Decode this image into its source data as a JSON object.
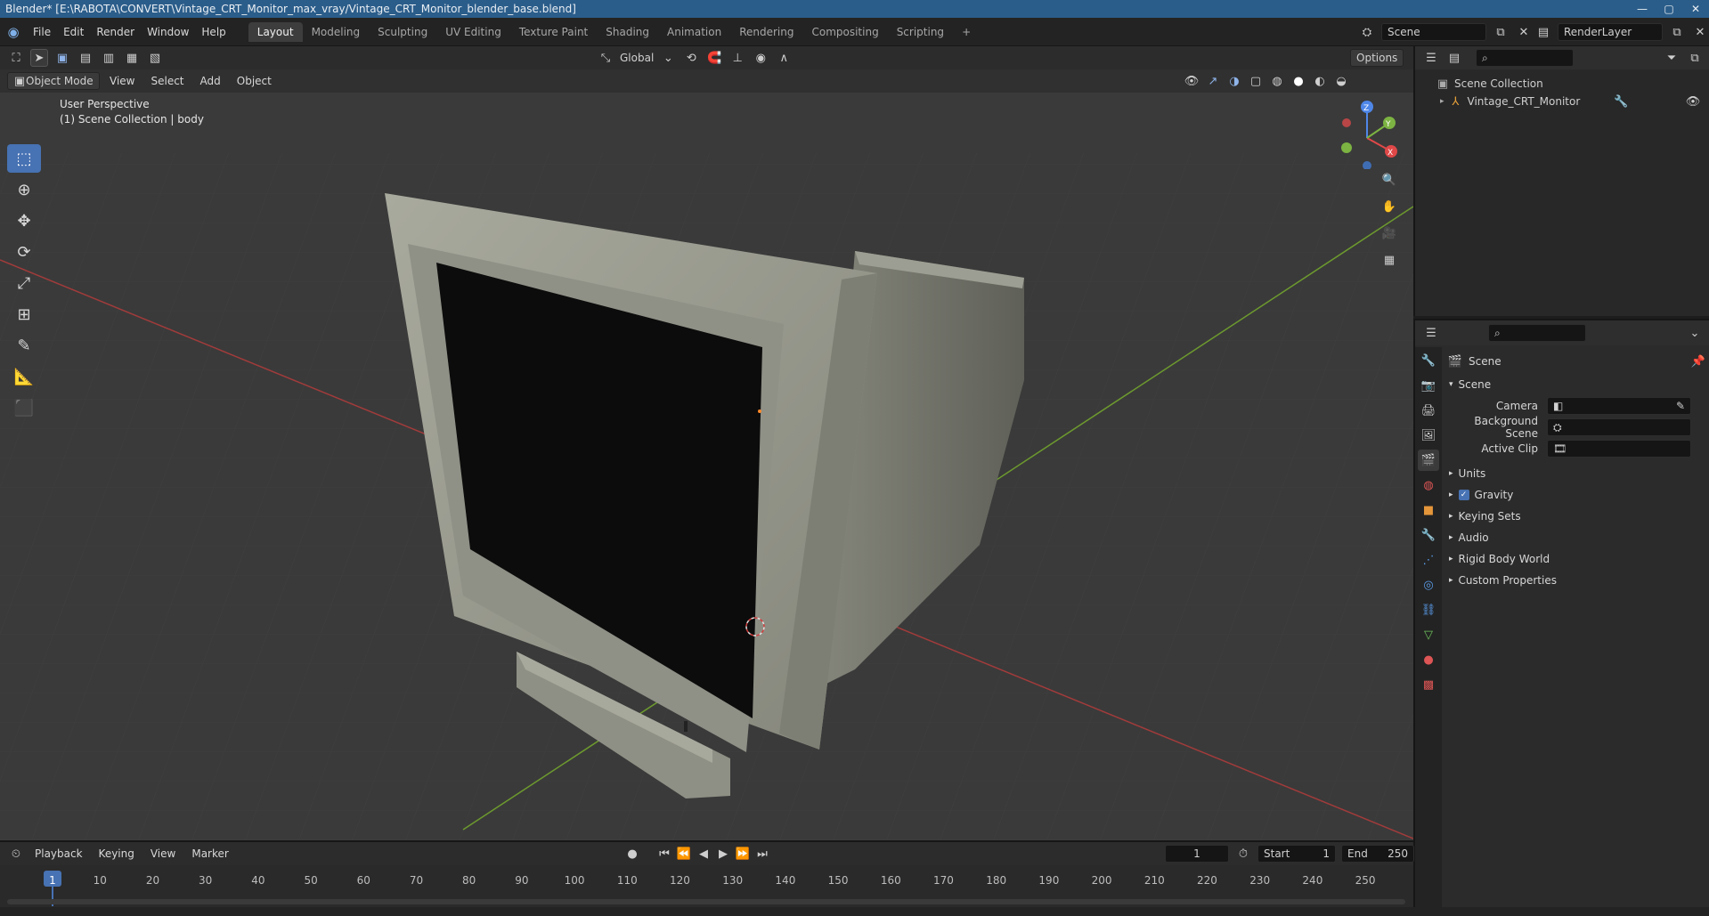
{
  "window": {
    "title": "Blender* [E:\\RABOTA\\CONVERT\\Vintage_CRT_Monitor_max_vray/Vintage_CRT_Monitor_blender_base.blend]"
  },
  "menu": [
    "File",
    "Edit",
    "Render",
    "Window",
    "Help"
  ],
  "workspaces": [
    "Layout",
    "Modeling",
    "Sculpting",
    "UV Editing",
    "Texture Paint",
    "Shading",
    "Animation",
    "Rendering",
    "Compositing",
    "Scripting"
  ],
  "scene_field": "Scene",
  "renderlayer_field": "RenderLayer",
  "viewport": {
    "transform_orientation": "Global",
    "options_label": "Options",
    "mode": "Object Mode",
    "menus": [
      "View",
      "Select",
      "Add",
      "Object"
    ],
    "overlay_title": "User Perspective",
    "overlay_sub": "(1) Scene Collection | body",
    "gizmo": {
      "z": "Z",
      "y": "Y",
      "x": "X"
    }
  },
  "outliner": {
    "root": "Scene Collection",
    "items": [
      {
        "name": "Vintage_CRT_Monitor"
      }
    ]
  },
  "properties": {
    "header": "Scene",
    "section": "Scene",
    "fields": [
      {
        "label": "Camera"
      },
      {
        "label": "Background Scene"
      },
      {
        "label": "Active Clip"
      }
    ],
    "subpanels": [
      "Units",
      "Gravity",
      "Keying Sets",
      "Audio",
      "Rigid Body World",
      "Custom Properties"
    ],
    "gravity_checked": true
  },
  "timeline": {
    "menus": [
      "Playback",
      "Keying",
      "View",
      "Marker"
    ],
    "current_frame": "1",
    "start_label": "Start",
    "start_value": "1",
    "end_label": "End",
    "end_value": "250",
    "ticks": [
      "1",
      "10",
      "20",
      "30",
      "40",
      "50",
      "60",
      "70",
      "80",
      "90",
      "100",
      "110",
      "120",
      "130",
      "140",
      "150",
      "160",
      "170",
      "180",
      "190",
      "200",
      "210",
      "220",
      "230",
      "240",
      "250"
    ]
  },
  "colors": {
    "accent": "#4772b3",
    "monitor_body": "#9a9b8f",
    "screen": "#0c0c0c",
    "grid_red": "#a23b3b",
    "grid_green": "#6d9a2e"
  }
}
